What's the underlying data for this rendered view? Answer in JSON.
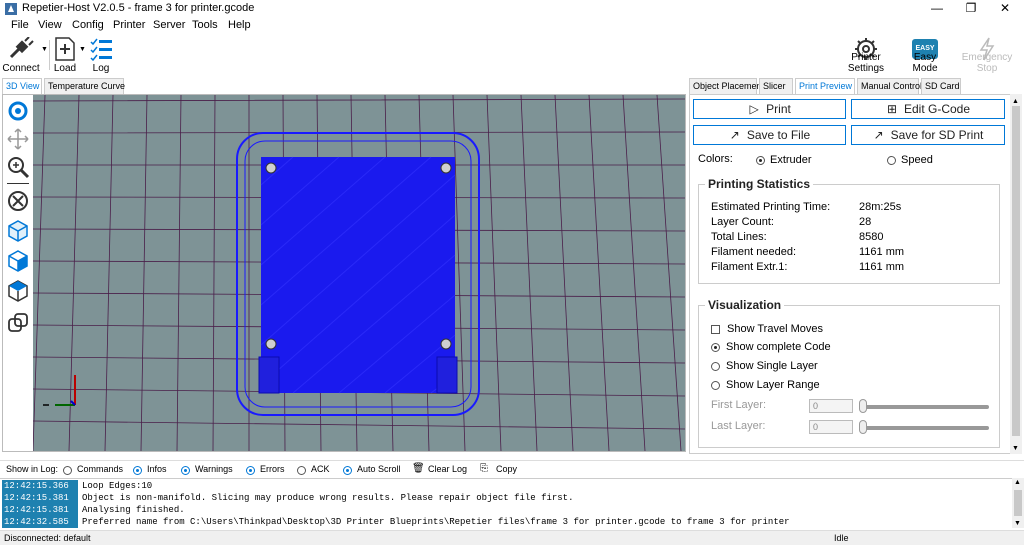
{
  "window": {
    "title": "Repetier-Host V2.0.5 - frame 3 for printer.gcode",
    "minimize": "—",
    "maximize": "❐",
    "close": "✕"
  },
  "menu": [
    "File",
    "View",
    "Config",
    "Printer",
    "Server",
    "Tools",
    "Help"
  ],
  "toolbar": {
    "connect": "Connect",
    "load": "Load",
    "log": "Log",
    "printer_settings": "Printer Settings",
    "easy_mode": "Easy Mode",
    "easy_badge": "EASY",
    "emergency_stop": "Emergency Stop"
  },
  "left_tabs": [
    "3D View",
    "Temperature Curve"
  ],
  "right_tabs": [
    "Object Placement",
    "Slicer",
    "Print Preview",
    "Manual Control",
    "SD Card"
  ],
  "preview": {
    "print": "Print",
    "edit_gcode": "Edit G-Code",
    "save_to_file": "Save to File",
    "save_sd": "Save for SD Print",
    "colors_label": "Colors:",
    "color_extruder": "Extruder",
    "color_speed": "Speed",
    "stats_title": "Printing Statistics",
    "stats": [
      {
        "k": "Estimated Printing Time:",
        "v": "28m:25s"
      },
      {
        "k": "Layer Count:",
        "v": "28"
      },
      {
        "k": "Total Lines:",
        "v": "8580"
      },
      {
        "k": "Filament needed:",
        "v": "1161 mm"
      },
      {
        "k": "Filament Extr.1:",
        "v": "1161 mm"
      }
    ],
    "viz_title": "Visualization",
    "viz": {
      "travel": "Show Travel Moves",
      "complete": "Show complete Code",
      "single": "Show Single Layer",
      "range": "Show Layer Range",
      "first_layer": "First Layer:",
      "last_layer": "Last Layer:",
      "first_value": "0",
      "last_value": "0"
    }
  },
  "logbar": {
    "show_in_log": "Show in Log:",
    "commands": "Commands",
    "infos": "Infos",
    "warnings": "Warnings",
    "errors": "Errors",
    "ack": "ACK",
    "auto_scroll": "Auto Scroll",
    "clear_log": "Clear Log",
    "copy": "Copy"
  },
  "log": [
    {
      "ts": "12:42:15.366",
      "msg": "Loop Edges:10"
    },
    {
      "ts": "12:42:15.381",
      "msg": "Object is non-manifold. Slicing may produce wrong results. Please repair object file first."
    },
    {
      "ts": "12:42:15.381",
      "msg": "Analysing finished."
    },
    {
      "ts": "12:42:32.585",
      "msg": "Preferred name from C:\\Users\\Thinkpad\\Desktop\\3D Printer Blueprints\\Repetier files\\frame 3 for printer.gcode to frame 3 for printer"
    }
  ],
  "status": {
    "left": "Disconnected: default",
    "right": "Idle"
  },
  "colors": {
    "accent": "#0078d7",
    "model": "#1a1aff",
    "bed": "#7e9396",
    "grid": "#4a1f4a"
  }
}
